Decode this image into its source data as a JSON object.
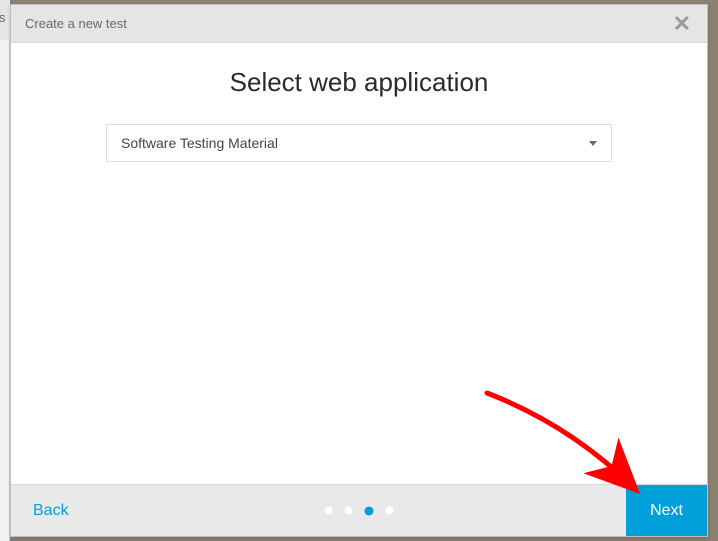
{
  "header": {
    "title": "Create a new test"
  },
  "body": {
    "heading": "Select web application",
    "dropdown": {
      "selected": "Software Testing Material"
    }
  },
  "footer": {
    "back_label": "Back",
    "next_label": "Next",
    "steps": {
      "total": 4,
      "active_index": 2
    }
  },
  "colors": {
    "accent": "#009fda"
  }
}
